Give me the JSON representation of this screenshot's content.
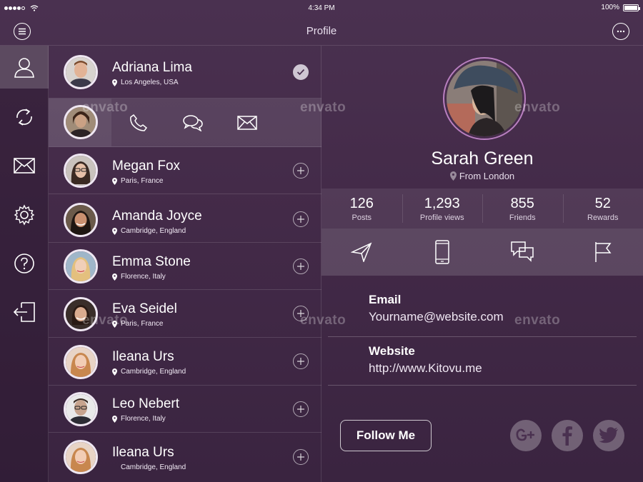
{
  "status_bar": {
    "time": "4:34 PM",
    "battery": "100%"
  },
  "nav": {
    "title": "Profile"
  },
  "sidebar": {
    "items": [
      {
        "icon": "user-icon",
        "active": true
      },
      {
        "icon": "sync-icon",
        "active": false
      },
      {
        "icon": "mail-icon",
        "active": false
      },
      {
        "icon": "gear-icon",
        "active": false
      },
      {
        "icon": "help-icon",
        "active": false
      },
      {
        "icon": "logout-icon",
        "active": false
      }
    ]
  },
  "contacts": [
    {
      "name": "Adriana Lima",
      "location": "Los Angeles, USA",
      "state": "checked"
    },
    {
      "name": "",
      "location": "",
      "state": "swiped"
    },
    {
      "name": "Megan Fox",
      "location": "Paris, France",
      "state": "add"
    },
    {
      "name": "Amanda Joyce",
      "location": "Cambridge, England",
      "state": "add"
    },
    {
      "name": "Emma Stone",
      "location": "Florence, Italy",
      "state": "add"
    },
    {
      "name": "Eva Seidel",
      "location": "Paris, France",
      "state": "add"
    },
    {
      "name": "Ileana Urs",
      "location": "Cambridge, England",
      "state": "add"
    },
    {
      "name": "Leo Nebert",
      "location": "Florence, Italy",
      "state": "add"
    },
    {
      "name": "Ileana Urs",
      "location": "Cambridge, England",
      "state": "add"
    }
  ],
  "profile": {
    "name": "Sarah Green",
    "location": "From London",
    "stats": [
      {
        "value": "126",
        "label": "Posts"
      },
      {
        "value": "1,293",
        "label": "Profile views"
      },
      {
        "value": "855",
        "label": "Friends"
      },
      {
        "value": "52",
        "label": "Rewards"
      }
    ],
    "email_label": "Email",
    "email": "Yourname@website.com",
    "website_label": "Website",
    "website": "http://www.Kitovu.me",
    "follow_label": "Follow Me"
  },
  "watermark": "envato"
}
